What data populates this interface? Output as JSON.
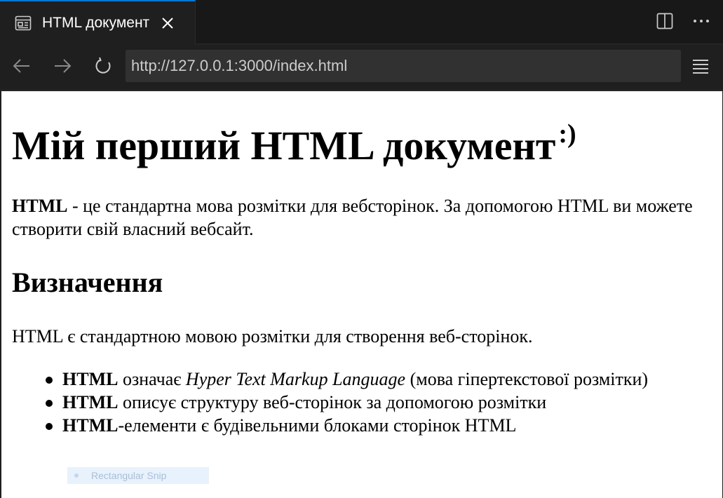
{
  "tab": {
    "title": "HTML документ",
    "icon": "preview-icon",
    "close_icon": "close-icon"
  },
  "tab_actions": [
    {
      "name": "split-editor-icon"
    },
    {
      "name": "more-actions-icon"
    }
  ],
  "nav": {
    "url": "http://127.0.0.1:3000/index.html"
  },
  "colors": {
    "accent": "#0078d4",
    "chrome_bg": "#1f1f1f",
    "page_bg": "#ffffff"
  },
  "content": {
    "h1_text": "Мій перший HTML документ",
    "h1_sup": ":)",
    "p1_bold": "HTML",
    "p1_rest": " - це стандартна мова розмітки для вебсторінок. За допомогою HTML ви можете створити свій власний вебсайт.",
    "h2": "Визначення",
    "p2": "HTML є стандартною мовою розмітки для створення веб-сторінок.",
    "list": [
      {
        "bold": "HTML",
        "text_before_italic": " означає ",
        "italic": "Hyper Text Markup Language",
        "text_after": " (мова гіпертекстової розмітки)"
      },
      {
        "bold": "HTML",
        "text": " описує структуру веб-сторінок за допомогою розмітки"
      },
      {
        "bold": "HTML",
        "text": "-елементи є будівельними блоками сторінок HTML"
      }
    ]
  },
  "overlay": {
    "snip_label": "Rectangular Snip"
  }
}
